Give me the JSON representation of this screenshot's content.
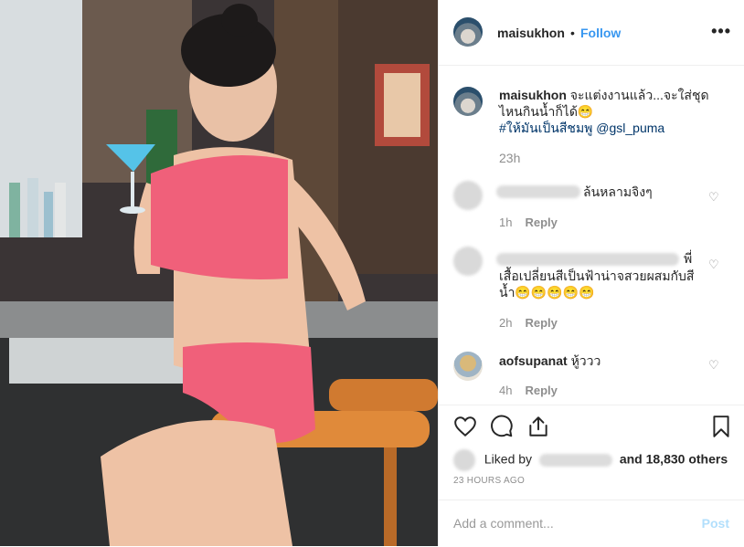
{
  "post": {
    "username": "maisukhon",
    "separator": "•",
    "follow_label": "Follow",
    "more_icon": "more-horizontal-icon"
  },
  "caption": {
    "username": "maisukhon",
    "text_line1": "จะแต่งงานแล้ว...จะใส่ชุด",
    "text_line2": "ไหนกินน้ำก็ได้😁",
    "hashtags": "#ให้มันเป็นสีชมพู @gsl_puma",
    "time": "23h"
  },
  "comments": [
    {
      "text": "ล้นหลามจิงๆ",
      "time": "1h",
      "reply_label": "Reply"
    },
    {
      "text_end": "พี่",
      "text_line2": "เสื้อเปลี่ยนสีเป็นฟ้าน่าจสวยผสมกับสี",
      "text_line3": "น้ำ😁😁😁😁😁",
      "time": "2h",
      "reply_label": "Reply"
    },
    {
      "username": "aofsupanat",
      "text": "หู้ววว",
      "time": "4h",
      "reply_label": "Reply"
    }
  ],
  "actions": {
    "like_icon": "heart-icon",
    "comment_icon": "comment-icon",
    "share_icon": "share-icon",
    "save_icon": "bookmark-icon"
  },
  "likes": {
    "prefix": "Liked by",
    "suffix": "and 18,830 others"
  },
  "timestamp": "23 HOURS AGO",
  "comment_box": {
    "placeholder": "Add a comment...",
    "post_label": "Post"
  },
  "colors": {
    "follow_blue": "#3897f0",
    "post_disabled": "#b2dffc",
    "secondary_text": "#8e8e8e"
  }
}
